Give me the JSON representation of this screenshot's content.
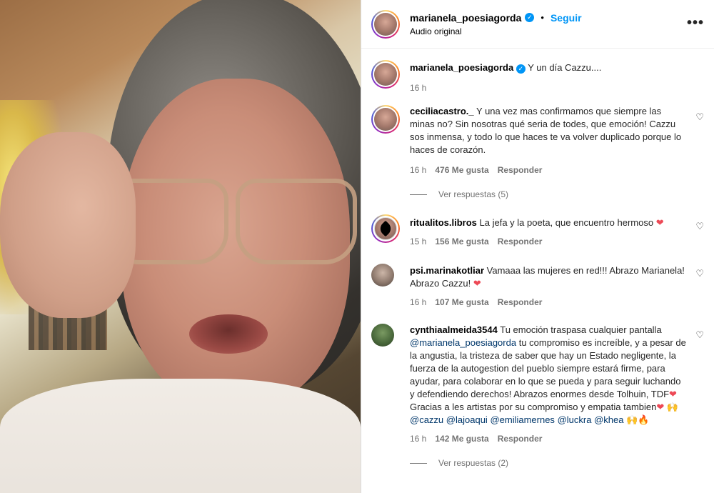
{
  "post": {
    "username": "marianela_poesiagorda",
    "follow_label": "Seguir",
    "separator": "•",
    "audio": "Audio original",
    "more_label": "•••"
  },
  "caption": {
    "username": "marianela_poesiagorda",
    "text": "Y un día Cazzu....",
    "time": "16 h"
  },
  "comments": [
    {
      "username": "ceciliacastro._",
      "text": "Y una vez mas confirmamos que siempre las minas no? Sin nosotras qué seria de todes, que emoción! Cazzu sos inmensa, y todo lo que haces te va volver duplicado porque lo haces de corazón.",
      "time": "16 h",
      "likes": "476 Me gusta",
      "reply": "Responder",
      "view_replies": "Ver respuestas (5)"
    },
    {
      "username": "ritualitos.libros",
      "text": "La jefa y la poeta, que encuentro hermoso",
      "time": "15 h",
      "likes": "156 Me gusta",
      "reply": "Responder"
    },
    {
      "username": "psi.marinakotliar",
      "text": "Vamaaa las mujeres en red!!! Abrazo Marianela! Abrazo Cazzu!",
      "time": "16 h",
      "likes": "107 Me gusta",
      "reply": "Responder"
    },
    {
      "username": "cynthiaalmeida3544",
      "text_a": "Tu emoción traspasa cualquier pantalla",
      "mention_a": "@marianela_poesiagorda",
      "text_b": "tu compromiso es increíble, y a pesar de la angustia, la tristeza de saber que hay un Estado negligente, la fuerza de la autogestion del pueblo siempre estará firme, para ayudar, para colaborar en lo que se pueda y para seguir luchando y defendiendo derechos! Abrazos enormes desde Tolhuin, TDF",
      "text_c": "Gracias a les artistas por su compromiso y empatia tambien",
      "mention_b": "@cazzu",
      "mention_c": "@lajoaqui",
      "mention_d": "@emiliamernes",
      "mention_e": "@luckra",
      "mention_f": "@khea",
      "time": "16 h",
      "likes": "142 Me gusta",
      "reply": "Responder",
      "view_replies": "Ver respuestas (2)"
    }
  ],
  "colors": {
    "link_blue": "#0095f6",
    "mention": "#00376b",
    "heart_red": "#ed4956",
    "meta_gray": "#737373"
  }
}
